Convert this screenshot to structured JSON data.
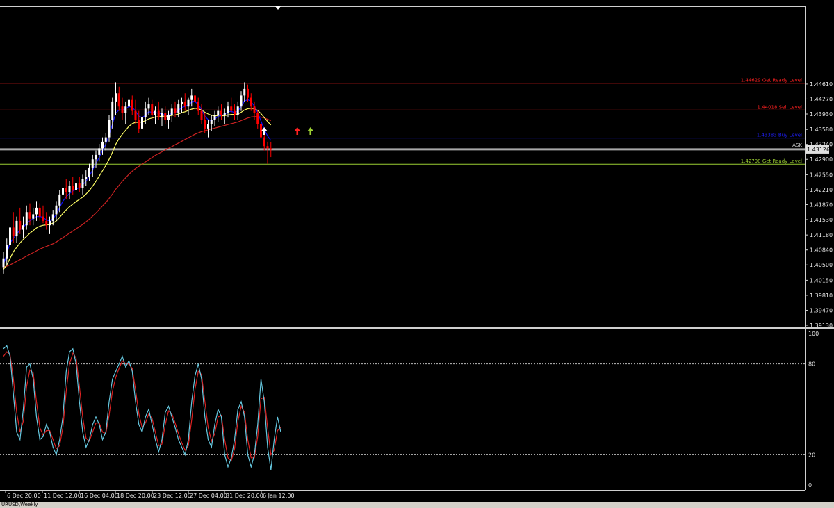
{
  "chart_data": [
    {
      "type": "candlestick",
      "series": [
        {
          "name": "price",
          "color_up": "#ffffff",
          "color_down": "#ff0000"
        },
        {
          "name": "fast-ma",
          "color": "#0b0bff"
        },
        {
          "name": "mid-ma",
          "color": "#ffff66"
        },
        {
          "name": "slow-ma",
          "color": "#cc2222"
        }
      ],
      "ylim": [
        1.3913,
        1.4633
      ],
      "y_ticks": [
        "1.44610",
        "1.44270",
        "1.43930",
        "1.43580",
        "1.43240",
        "1.42900",
        "1.42550",
        "1.42210",
        "1.41870",
        "1.41530",
        "1.41180",
        "1.40840",
        "1.40500",
        "1.40150",
        "1.39810",
        "1.39470",
        "1.39130"
      ],
      "levels": [
        {
          "value": 1.44629,
          "label": "1.44629 Get Ready Level",
          "color": "#ff2020"
        },
        {
          "value": 1.44018,
          "label": "1.44018 Sell Level",
          "color": "#ff2020"
        },
        {
          "value": 1.43383,
          "label": "1.43383 Buy Level",
          "color": "#1f1fff"
        },
        {
          "value": 1.4279,
          "label": "1.42790 Get Ready Level",
          "color": "#9acd32"
        }
      ],
      "ask": {
        "label": "ASK",
        "value": "1.43126"
      },
      "arrows": [
        {
          "x_index": 79,
          "color": "#ffffff"
        },
        {
          "x_index": 89,
          "color": "#ff2020"
        },
        {
          "x_index": 93,
          "color": "#9acd32"
        }
      ],
      "candles": [
        [
          1.4045,
          1.408,
          1.403,
          1.4065
        ],
        [
          1.4065,
          1.411,
          1.405,
          1.4095
        ],
        [
          1.4095,
          1.415,
          1.408,
          1.4135
        ],
        [
          1.4135,
          1.417,
          1.41,
          1.4115
        ],
        [
          1.4115,
          1.416,
          1.41,
          1.415
        ],
        [
          1.415,
          1.418,
          1.412,
          1.413
        ],
        [
          1.413,
          1.416,
          1.411,
          1.414
        ],
        [
          1.414,
          1.4185,
          1.413,
          1.417
        ],
        [
          1.417,
          1.419,
          1.414,
          1.4155
        ],
        [
          1.4155,
          1.418,
          1.414,
          1.4165
        ],
        [
          1.4165,
          1.4195,
          1.415,
          1.418
        ],
        [
          1.418,
          1.419,
          1.415,
          1.416
        ],
        [
          1.416,
          1.4185,
          1.4145,
          1.415
        ],
        [
          1.415,
          1.417,
          1.413,
          1.414
        ],
        [
          1.414,
          1.416,
          1.412,
          1.415
        ],
        [
          1.415,
          1.4175,
          1.414,
          1.4165
        ],
        [
          1.4165,
          1.4195,
          1.415,
          1.4185
        ],
        [
          1.4185,
          1.422,
          1.417,
          1.421
        ],
        [
          1.421,
          1.424,
          1.419,
          1.4225
        ],
        [
          1.4225,
          1.4245,
          1.42,
          1.4215
        ],
        [
          1.4215,
          1.424,
          1.42,
          1.423
        ],
        [
          1.423,
          1.425,
          1.421,
          1.422
        ],
        [
          1.422,
          1.4245,
          1.4205,
          1.4235
        ],
        [
          1.4235,
          1.425,
          1.4215,
          1.4225
        ],
        [
          1.4225,
          1.4255,
          1.421,
          1.4245
        ],
        [
          1.4245,
          1.4265,
          1.423,
          1.425
        ],
        [
          1.425,
          1.428,
          1.424,
          1.427
        ],
        [
          1.427,
          1.43,
          1.425,
          1.429
        ],
        [
          1.429,
          1.431,
          1.427,
          1.43
        ],
        [
          1.43,
          1.4325,
          1.4285,
          1.4315
        ],
        [
          1.4315,
          1.434,
          1.43,
          1.433
        ],
        [
          1.433,
          1.435,
          1.431,
          1.434
        ],
        [
          1.434,
          1.439,
          1.433,
          1.438
        ],
        [
          1.438,
          1.443,
          1.436,
          1.442
        ],
        [
          1.442,
          1.4465,
          1.439,
          1.444
        ],
        [
          1.444,
          1.4455,
          1.44,
          1.441
        ],
        [
          1.441,
          1.443,
          1.438,
          1.4395
        ],
        [
          1.4395,
          1.442,
          1.437,
          1.441
        ],
        [
          1.441,
          1.444,
          1.4395,
          1.4425
        ],
        [
          1.4425,
          1.4435,
          1.439,
          1.44
        ],
        [
          1.44,
          1.4425,
          1.437,
          1.438
        ],
        [
          1.438,
          1.44,
          1.435,
          1.436
        ],
        [
          1.436,
          1.4395,
          1.435,
          1.4385
        ],
        [
          1.4385,
          1.442,
          1.437,
          1.4405
        ],
        [
          1.4405,
          1.443,
          1.439,
          1.4415
        ],
        [
          1.4415,
          1.4425,
          1.438,
          1.439
        ],
        [
          1.439,
          1.441,
          1.437,
          1.44
        ],
        [
          1.44,
          1.442,
          1.438,
          1.4385
        ],
        [
          1.4385,
          1.4405,
          1.4365,
          1.4395
        ],
        [
          1.4395,
          1.441,
          1.437,
          1.438
        ],
        [
          1.438,
          1.44,
          1.436,
          1.439
        ],
        [
          1.439,
          1.4415,
          1.4375,
          1.4405
        ],
        [
          1.4405,
          1.442,
          1.4385,
          1.4395
        ],
        [
          1.4395,
          1.4425,
          1.4385,
          1.4415
        ],
        [
          1.4415,
          1.443,
          1.4395,
          1.442
        ],
        [
          1.442,
          1.444,
          1.44,
          1.441
        ],
        [
          1.441,
          1.443,
          1.439,
          1.4425
        ],
        [
          1.4425,
          1.445,
          1.441,
          1.4435
        ],
        [
          1.4435,
          1.4445,
          1.4405,
          1.442
        ],
        [
          1.442,
          1.443,
          1.439,
          1.44
        ],
        [
          1.44,
          1.4415,
          1.437,
          1.438
        ],
        [
          1.438,
          1.4395,
          1.435,
          1.436
        ],
        [
          1.436,
          1.438,
          1.434,
          1.437
        ],
        [
          1.437,
          1.439,
          1.4355,
          1.438
        ],
        [
          1.438,
          1.44,
          1.4365,
          1.439
        ],
        [
          1.439,
          1.441,
          1.4375,
          1.44
        ],
        [
          1.44,
          1.4415,
          1.438,
          1.439
        ],
        [
          1.439,
          1.4405,
          1.437,
          1.4395
        ],
        [
          1.4395,
          1.442,
          1.4385,
          1.441
        ],
        [
          1.441,
          1.443,
          1.4395,
          1.44
        ],
        [
          1.44,
          1.4415,
          1.438,
          1.439
        ],
        [
          1.439,
          1.442,
          1.438,
          1.441
        ],
        [
          1.441,
          1.4445,
          1.44,
          1.4435
        ],
        [
          1.4435,
          1.4465,
          1.442,
          1.445
        ],
        [
          1.445,
          1.446,
          1.442,
          1.443
        ],
        [
          1.443,
          1.444,
          1.44,
          1.441
        ],
        [
          1.441,
          1.442,
          1.438,
          1.4395
        ],
        [
          1.4395,
          1.44,
          1.436,
          1.437
        ],
        [
          1.437,
          1.438,
          1.433,
          1.434
        ],
        [
          1.434,
          1.435,
          1.431,
          1.432
        ],
        [
          1.432,
          1.433,
          1.428,
          1.4315
        ],
        [
          1.4315,
          1.433,
          1.4295,
          1.4312
        ]
      ],
      "ma_fast": [
        1.405,
        1.4075,
        1.41,
        1.411,
        1.412,
        1.413,
        1.4135,
        1.4145,
        1.415,
        1.4155,
        1.416,
        1.416,
        1.4158,
        1.4152,
        1.415,
        1.4155,
        1.4165,
        1.418,
        1.4195,
        1.4205,
        1.4212,
        1.4218,
        1.4222,
        1.4226,
        1.4232,
        1.424,
        1.4252,
        1.4266,
        1.428,
        1.4295,
        1.431,
        1.4325,
        1.4345,
        1.437,
        1.4395,
        1.4402,
        1.4402,
        1.4404,
        1.441,
        1.4408,
        1.44,
        1.4388,
        1.4385,
        1.439,
        1.4398,
        1.4397,
        1.4397,
        1.4394,
        1.4394,
        1.439,
        1.439,
        1.4395,
        1.4396,
        1.4401,
        1.4408,
        1.441,
        1.4414,
        1.442,
        1.4421,
        1.4415,
        1.4403,
        1.4388,
        1.438,
        1.4378,
        1.4381,
        1.4388,
        1.439,
        1.4392,
        1.4398,
        1.4399,
        1.4396,
        1.44,
        1.441,
        1.4422,
        1.4426,
        1.4421,
        1.4411,
        1.4396,
        1.4377,
        1.4358,
        1.4343,
        1.4333
      ],
      "ma_mid": [
        1.404,
        1.405,
        1.4065,
        1.408,
        1.409,
        1.41,
        1.4108,
        1.4115,
        1.4122,
        1.4128,
        1.4134,
        1.4138,
        1.414,
        1.4141,
        1.4142,
        1.4145,
        1.415,
        1.4158,
        1.4167,
        1.4175,
        1.4182,
        1.4188,
        1.4194,
        1.4199,
        1.4204,
        1.4211,
        1.4219,
        1.4229,
        1.424,
        1.4252,
        1.4264,
        1.4276,
        1.429,
        1.4306,
        1.4324,
        1.4337,
        1.4347,
        1.4356,
        1.4365,
        1.4371,
        1.4374,
        1.4374,
        1.4375,
        1.4378,
        1.4382,
        1.4384,
        1.4386,
        1.4387,
        1.4388,
        1.4388,
        1.4388,
        1.439,
        1.4391,
        1.4393,
        1.4396,
        1.4398,
        1.4401,
        1.4404,
        1.4406,
        1.4405,
        1.4402,
        1.4397,
        1.4393,
        1.439,
        1.4389,
        1.4389,
        1.4389,
        1.4389,
        1.4391,
        1.4392,
        1.4392,
        1.4393,
        1.4397,
        1.4402,
        1.4405,
        1.4406,
        1.4405,
        1.4401,
        1.4394,
        1.4385,
        1.4376,
        1.4368
      ],
      "ma_slow": [
        1.4045,
        1.4047,
        1.405,
        1.4054,
        1.4058,
        1.4062,
        1.4066,
        1.407,
        1.4074,
        1.4078,
        1.4082,
        1.4086,
        1.4089,
        1.4092,
        1.4095,
        1.4098,
        1.4102,
        1.4107,
        1.4112,
        1.4117,
        1.4122,
        1.4127,
        1.4132,
        1.4137,
        1.4142,
        1.4148,
        1.4154,
        1.4161,
        1.4168,
        1.4176,
        1.4184,
        1.4192,
        1.4201,
        1.4211,
        1.4222,
        1.4231,
        1.424,
        1.4248,
        1.4256,
        1.4263,
        1.4269,
        1.4274,
        1.4279,
        1.4284,
        1.4289,
        1.4294,
        1.4299,
        1.4303,
        1.4307,
        1.4311,
        1.4315,
        1.4319,
        1.4323,
        1.4327,
        1.4331,
        1.4335,
        1.4339,
        1.4343,
        1.4347,
        1.435,
        1.4353,
        1.4355,
        1.4357,
        1.4359,
        1.4361,
        1.4363,
        1.4365,
        1.4367,
        1.4369,
        1.4371,
        1.4373,
        1.4375,
        1.4378,
        1.4381,
        1.4384,
        1.4386,
        1.4387,
        1.4387,
        1.4386,
        1.4384,
        1.4381,
        1.4378
      ]
    },
    {
      "type": "line",
      "ylim": [
        0,
        100
      ],
      "y_ticks": [
        "100",
        "80",
        "20",
        "0"
      ],
      "levels": [
        80,
        20
      ],
      "series": [
        {
          "name": "main",
          "color": "#66c8e0",
          "values": [
            90,
            92,
            85,
            60,
            35,
            30,
            50,
            78,
            80,
            70,
            45,
            30,
            32,
            40,
            35,
            25,
            20,
            30,
            45,
            75,
            88,
            90,
            80,
            55,
            35,
            25,
            30,
            40,
            45,
            40,
            30,
            35,
            55,
            70,
            75,
            80,
            85,
            78,
            82,
            75,
            55,
            40,
            35,
            45,
            50,
            40,
            30,
            22,
            30,
            48,
            52,
            45,
            38,
            30,
            25,
            20,
            30,
            55,
            72,
            80,
            70,
            45,
            30,
            25,
            40,
            50,
            45,
            20,
            12,
            18,
            30,
            50,
            55,
            45,
            20,
            12,
            20,
            40,
            70,
            55,
            25,
            10,
            30,
            45,
            35
          ]
        },
        {
          "name": "signal",
          "color": "#dd2222",
          "values": [
            85,
            88,
            86,
            70,
            48,
            35,
            42,
            65,
            76,
            74,
            55,
            38,
            33,
            36,
            36,
            30,
            24,
            26,
            38,
            62,
            80,
            87,
            84,
            65,
            45,
            31,
            29,
            35,
            41,
            41,
            35,
            34,
            46,
            62,
            71,
            77,
            82,
            80,
            80,
            77,
            63,
            47,
            38,
            41,
            47,
            44,
            35,
            26,
            27,
            40,
            49,
            47,
            41,
            34,
            28,
            23,
            26,
            43,
            63,
            75,
            73,
            55,
            38,
            29,
            34,
            45,
            46,
            30,
            18,
            16,
            24,
            42,
            52,
            48,
            30,
            18,
            18,
            32,
            57,
            58,
            38,
            20,
            23,
            36,
            38
          ]
        }
      ]
    }
  ],
  "time_labels": [
    "6 Dec 20:00",
    "11 Dec 12:00",
    "16 Dec 04:00",
    "18 Dec 20:00",
    "23 Dec 12:00",
    "27 Dec 04:00",
    "31 Dec 20:00",
    "6 Jan 12:00"
  ],
  "bottom_tab": "URUSD,Weekly"
}
